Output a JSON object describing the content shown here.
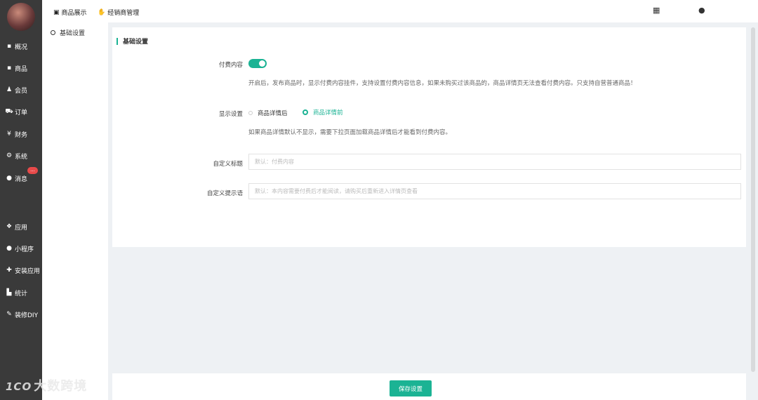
{
  "sidebar": {
    "items": [
      {
        "label": "概况",
        "icon": "dashboard-icon",
        "glyph": "▪"
      },
      {
        "label": "商品",
        "icon": "goods-icon",
        "glyph": "▪"
      },
      {
        "label": "会员",
        "icon": "members-icon",
        "glyph": "♟"
      },
      {
        "label": "订单",
        "icon": "cart-icon",
        "glyph": "⛟"
      },
      {
        "label": "财务",
        "icon": "yen-icon",
        "glyph": "¥"
      },
      {
        "label": "系统",
        "icon": "gears-icon",
        "glyph": "⚙"
      },
      {
        "label": "消息",
        "icon": "chat-icon",
        "glyph": "●"
      },
      {
        "label": "应用",
        "icon": "cubes-icon",
        "glyph": "❖"
      },
      {
        "label": "小程序",
        "icon": "wechat-icon",
        "glyph": "●"
      },
      {
        "label": "安装应用",
        "icon": "puzzle-icon",
        "glyph": "✚"
      },
      {
        "label": "统计",
        "icon": "bar-chart-icon",
        "glyph": "▙"
      },
      {
        "label": "装修DIY",
        "icon": "wrench-icon",
        "glyph": "✎"
      }
    ],
    "message_badge": "..."
  },
  "topbar": {
    "tab1": "商品展示",
    "tab2": "经销商管理"
  },
  "subnav": {
    "item": "基础设置"
  },
  "panel": {
    "section_title": "基础设置",
    "paid_content_label": "付费内容",
    "paid_content_enabled": true,
    "paid_content_hint": "开启后，发布商品时，显示付费内容挂件，支持设置付费内容信息，如果未购买过该商品的，商品详情页无法查看付费内容。只支持自营普通商品！",
    "display_label": "显示设置",
    "display_options": [
      "商品详情后",
      "商品详情前"
    ],
    "display_selected": "商品详情前",
    "display_hint": "如果商品详情默认不显示，需要下拉页面加载商品详情后才能看到付费内容。",
    "custom_title_label": "自定义标题",
    "custom_title_placeholder": "默认：付费内容",
    "custom_tip_label": "自定义提示语",
    "custom_tip_placeholder": "默认：本内容需要付费后才能阅读，请购买后重新进入详情页查看"
  },
  "footer": {
    "save_label": "保存设置"
  },
  "watermark": "大数跨境",
  "colors": {
    "accent": "#1bb394",
    "sidebar_bg": "#3a3a3a",
    "badge": "#e84a4a"
  }
}
